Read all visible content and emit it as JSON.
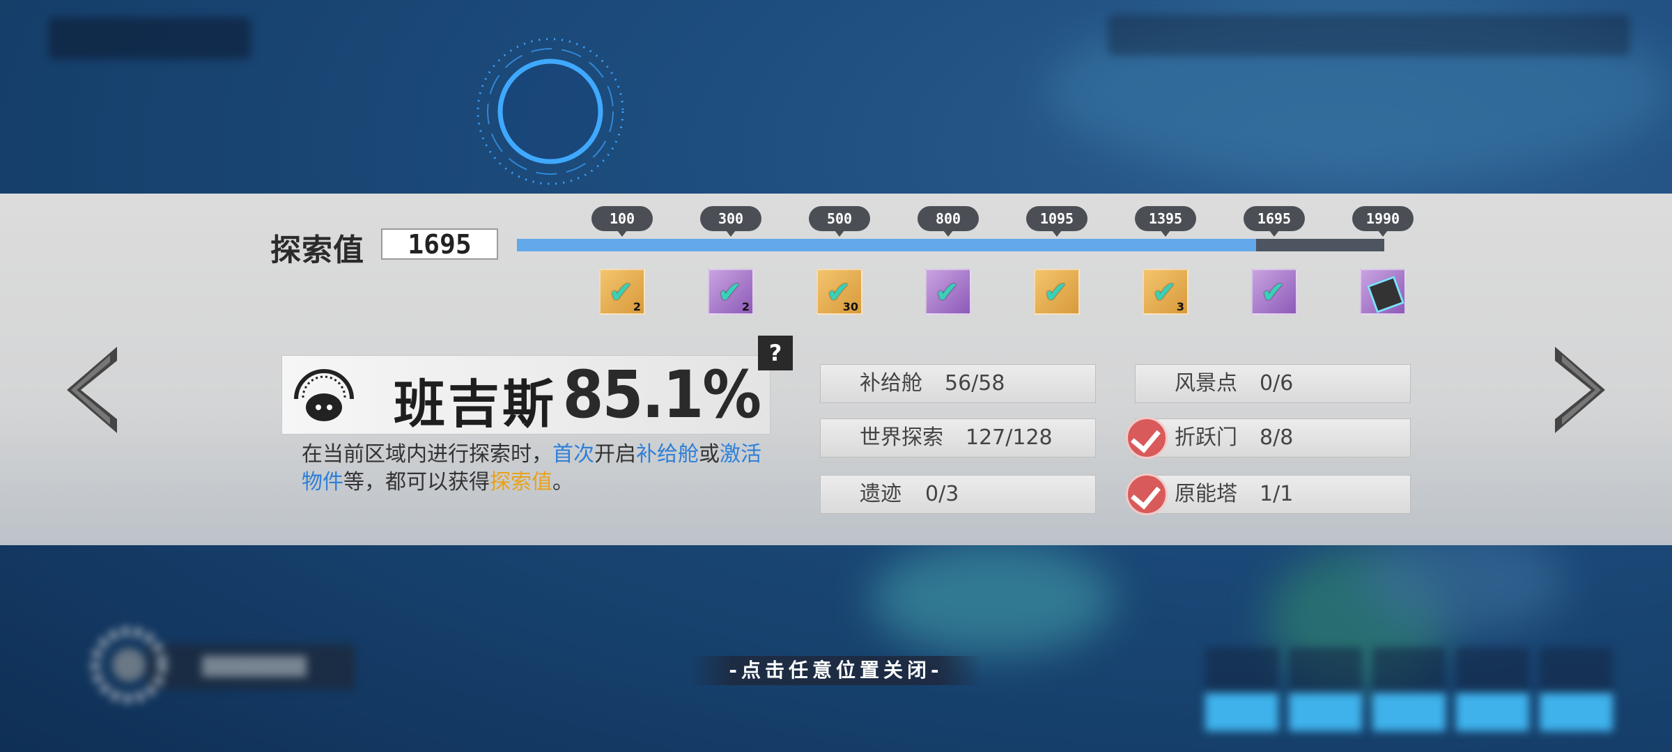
{
  "explore": {
    "label": "探索值",
    "value": "1695",
    "progress_fraction": 0.852,
    "milestones": [
      "100",
      "300",
      "500",
      "800",
      "1095",
      "1395",
      "1695",
      "1990"
    ],
    "rewards": [
      {
        "style": "gold",
        "qty": "2",
        "claimed": true
      },
      {
        "style": "purple",
        "qty": "2",
        "claimed": true
      },
      {
        "style": "gold",
        "qty": "30",
        "claimed": true
      },
      {
        "style": "purple",
        "qty": "",
        "claimed": true
      },
      {
        "style": "gold",
        "qty": "",
        "claimed": true
      },
      {
        "style": "gold",
        "qty": "3",
        "claimed": true
      },
      {
        "style": "purple",
        "qty": "",
        "claimed": true
      },
      {
        "style": "purple",
        "qty": "",
        "claimed": false
      }
    ]
  },
  "region": {
    "name": "班吉斯",
    "percent": "85.1%",
    "help": "?"
  },
  "description": {
    "p1": "在当前区域内进行探索时，",
    "h1": "首次",
    "p2": "开启",
    "h2": "补给舱",
    "p3": "或",
    "h3": "激活物件",
    "p4": "等，都可以获得",
    "h4": "探索值",
    "p5": "。"
  },
  "stats": {
    "supply_pod": {
      "label": "补给舱",
      "value": "56/58"
    },
    "world_explore": {
      "label": "世界探索",
      "value": "127/128"
    },
    "ruins": {
      "label": "遗迹",
      "value": "0/3"
    },
    "scenic": {
      "label": "风景点",
      "value": "0/6"
    },
    "warp_gate": {
      "label": "折跃门",
      "value": "8/8"
    },
    "tower": {
      "label": "原能塔",
      "value": "1/1"
    }
  },
  "close_hint": "-点击任意位置关闭-",
  "colors": {
    "progress": "#62a8ea",
    "highlight_blue": "#2e7fd8",
    "highlight_gold": "#e8a21a",
    "check_red": "#d85a5a",
    "reward_check": "#3ad0b8"
  }
}
